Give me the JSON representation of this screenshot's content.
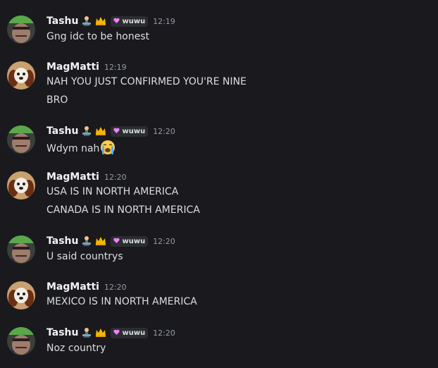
{
  "colors": {
    "background": "#1a1a1e",
    "username": "#f2f3f5",
    "text": "#dbdee1",
    "timestamp": "#949ba4",
    "tag_bg": "#2b2d31",
    "tag_heart": "#f47fff"
  },
  "messages": [
    {
      "user": "Tashu",
      "has_badges": true,
      "tag": "wuwu",
      "time": "12:19",
      "lines": [
        "Gng idc to be honest"
      ]
    },
    {
      "user": "MagMatti",
      "has_badges": false,
      "time": "12:19",
      "lines": [
        "NAH YOU JUST CONFIRMED YOU'RE NINE",
        "BRO"
      ]
    },
    {
      "user": "Tashu",
      "has_badges": true,
      "tag": "wuwu",
      "time": "12:20",
      "lines": [
        "Wdym nah"
      ],
      "emoji": "loudly-crying-face"
    },
    {
      "user": "MagMatti",
      "has_badges": false,
      "time": "12:20",
      "lines": [
        "USA IS IN NORTH AMERICA",
        "CANADA IS IN NORTH AMERICA"
      ]
    },
    {
      "user": "Tashu",
      "has_badges": true,
      "tag": "wuwu",
      "time": "12:20",
      "lines": [
        "U said countrys"
      ]
    },
    {
      "user": "MagMatti",
      "has_badges": false,
      "time": "12:20",
      "lines": [
        "MEXICO IS IN NORTH AMERICA"
      ]
    },
    {
      "user": "Tashu",
      "has_badges": true,
      "tag": "wuwu",
      "time": "12:20",
      "lines": [
        "Noz country"
      ]
    }
  ],
  "icons": {
    "tashu_badge_1": "technologist-icon",
    "tashu_badge_2": "crown-icon",
    "tag_icon": "heart-icon"
  }
}
